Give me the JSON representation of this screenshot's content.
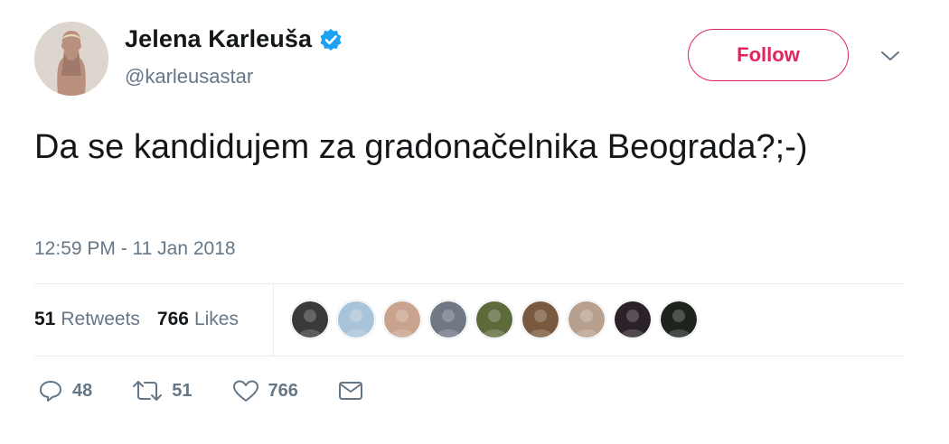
{
  "author": {
    "name": "Jelena Karleuša",
    "handle": "@karleusastar",
    "verified_icon": "verified-badge-icon"
  },
  "header": {
    "follow_label": "Follow",
    "accent_color": "#e0245e",
    "more_icon": "chevron-down-icon"
  },
  "tweet": {
    "text": "Da se kandidujem za gradonačelnika Beograda?;-)",
    "timestamp": "12:59 PM - 11 Jan 2018"
  },
  "stats": {
    "retweets_count": "51",
    "retweets_label": "Retweets",
    "likes_count": "766",
    "likes_label": "Likes"
  },
  "likers": [
    {
      "name": "liker-avatar-1",
      "color": "#3a3a3a"
    },
    {
      "name": "liker-avatar-2",
      "color": "#a9c3d8"
    },
    {
      "name": "liker-avatar-3",
      "color": "#c9a38d"
    },
    {
      "name": "liker-avatar-4",
      "color": "#6f7884"
    },
    {
      "name": "liker-avatar-5",
      "color": "#5d6b3b"
    },
    {
      "name": "liker-avatar-6",
      "color": "#7a5a3e"
    },
    {
      "name": "liker-avatar-7",
      "color": "#b8a08e"
    },
    {
      "name": "liker-avatar-8",
      "color": "#2a2228"
    },
    {
      "name": "liker-avatar-9",
      "color": "#1e241c"
    }
  ],
  "actions": {
    "reply_count": "48",
    "retweet_count": "51",
    "like_count": "766",
    "reply_icon": "reply-icon",
    "retweet_icon": "retweet-icon",
    "like_icon": "heart-icon",
    "message_icon": "envelope-icon"
  }
}
